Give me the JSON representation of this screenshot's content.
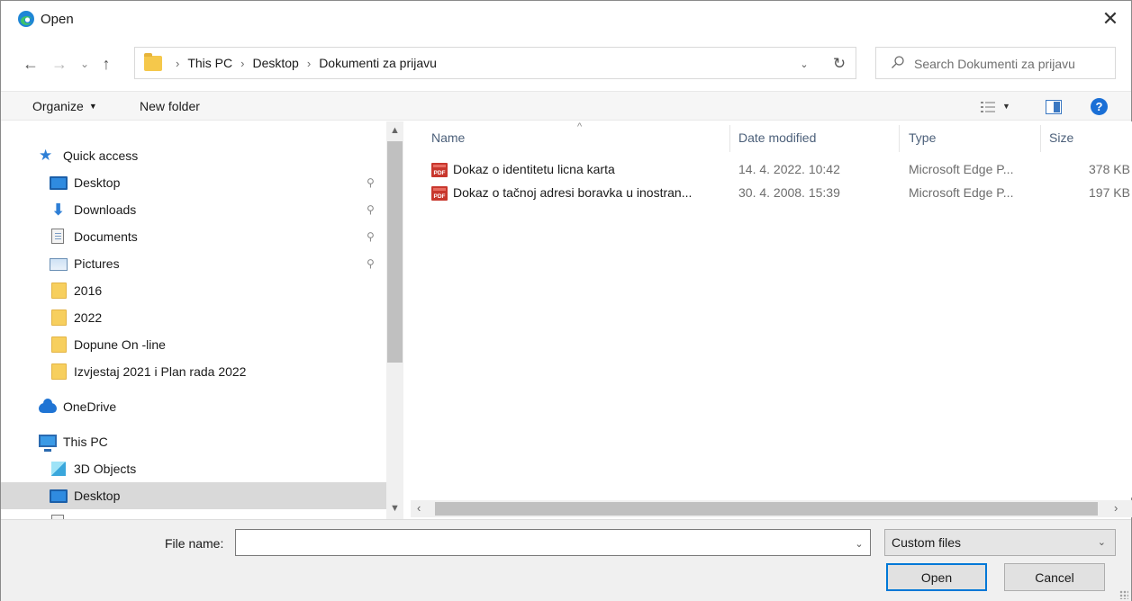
{
  "window": {
    "title": "Open",
    "close_glyph": "✕",
    "accent_color": "#0078d7"
  },
  "navigation": {
    "back_glyph": "←",
    "forward_glyph": "→",
    "recent_glyph": "⌄",
    "up_glyph": "↑"
  },
  "address_bar": {
    "breadcrumbs": [
      "This PC",
      "Desktop",
      "Dokumenti za prijavu"
    ],
    "separator": "›",
    "dropdown_glyph": "⌄",
    "refresh_glyph": "↻"
  },
  "search": {
    "placeholder": "Search Dokumenti za prijavu"
  },
  "toolbar": {
    "organize_label": "Organize",
    "organize_caret": "▼",
    "new_folder_label": "New folder",
    "view_caret": "▼",
    "help_label": "?"
  },
  "nav_pane": {
    "items": [
      {
        "label": "Quick access",
        "icon": "quick-access-star-icon",
        "pinned": false
      },
      {
        "label": "Desktop",
        "icon": "desktop-icon",
        "pinned": true
      },
      {
        "label": "Downloads",
        "icon": "download-icon",
        "pinned": true
      },
      {
        "label": "Documents",
        "icon": "documents-icon",
        "pinned": true
      },
      {
        "label": "Pictures",
        "icon": "pictures-icon",
        "pinned": true
      },
      {
        "label": "2016",
        "icon": "folder-icon",
        "pinned": false
      },
      {
        "label": "2022",
        "icon": "folder-icon",
        "pinned": false
      },
      {
        "label": "Dopune On -line",
        "icon": "folder-icon",
        "pinned": false
      },
      {
        "label": "Izvjestaj 2021 i Plan rada 2022",
        "icon": "folder-icon",
        "pinned": false
      },
      {
        "label": "OneDrive",
        "icon": "onedrive-icon",
        "pinned": false
      },
      {
        "label": "This PC",
        "icon": "this-pc-icon",
        "pinned": false
      },
      {
        "label": "3D Objects",
        "icon": "3d-objects-icon",
        "pinned": false
      },
      {
        "label": "Desktop",
        "icon": "desktop-icon",
        "pinned": false,
        "selected": true
      }
    ],
    "pin_glyph": "📌"
  },
  "file_list": {
    "columns": [
      "Name",
      "Date modified",
      "Type",
      "Size"
    ],
    "sort_glyph": "^",
    "rows": [
      {
        "name": "Dokaz o identitetu licna karta",
        "date": "14. 4. 2022. 10:42",
        "type": "Microsoft Edge P...",
        "size": "378 KB"
      },
      {
        "name": "Dokaz o tačnoj adresi boravka u inostran...",
        "date": "30. 4. 2008. 15:39",
        "type": "Microsoft Edge P...",
        "size": "197 KB"
      }
    ]
  },
  "bottom": {
    "file_name_label": "File name:",
    "file_name_value": "",
    "file_type_selected": "Custom files",
    "open_label": "Open",
    "cancel_label": "Cancel",
    "dropdown_glyph": "⌄"
  }
}
